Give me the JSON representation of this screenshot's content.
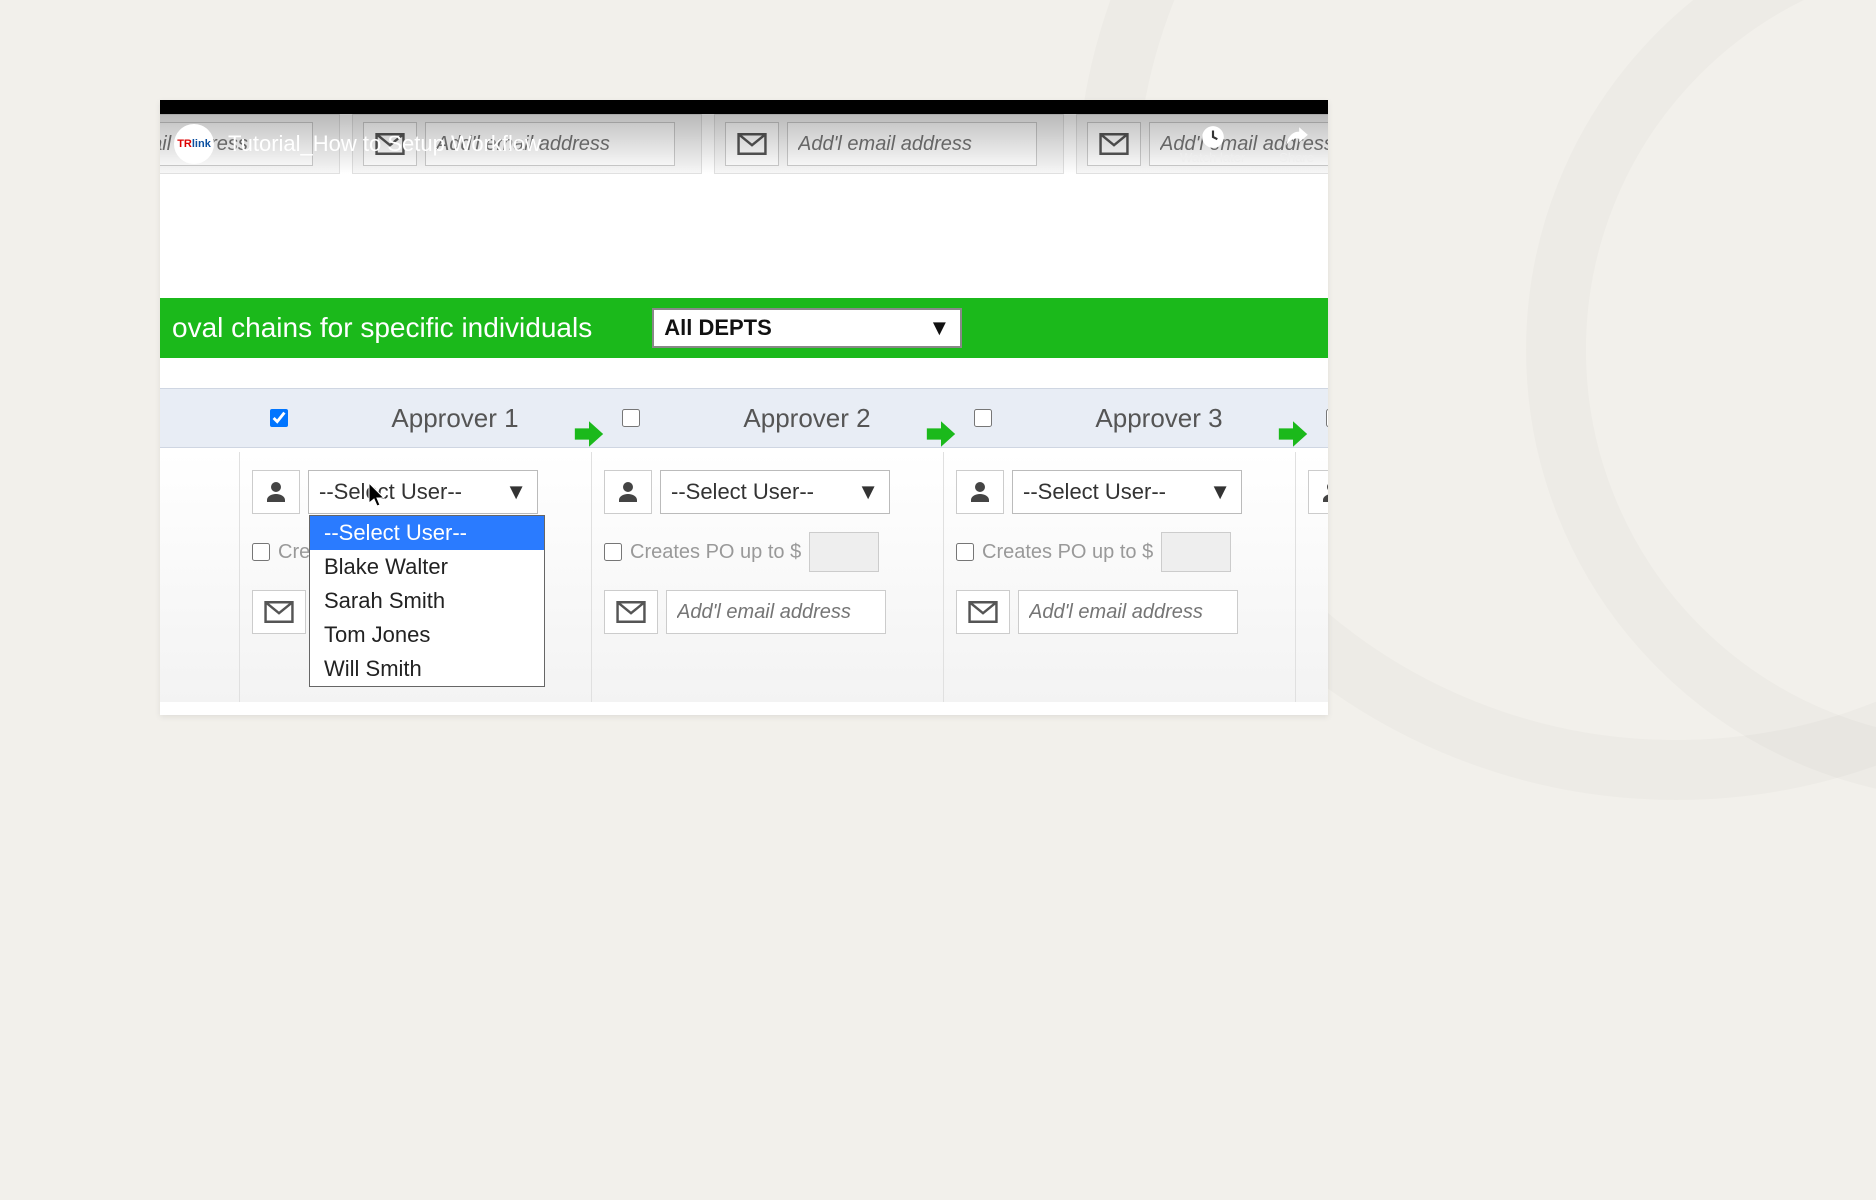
{
  "video": {
    "title": "Tutorial_How to Setup Workflow",
    "channel_logo_text": "TRlink",
    "watch_later_label": "Watch later",
    "share_label": "Share"
  },
  "banner": {
    "text_fragment": "oval chains for specific individuals",
    "dept_select_value": "All DEPTS"
  },
  "email_placeholder": "Add'l email address",
  "approvers": {
    "columns": [
      {
        "label": "Approver 1",
        "checked": true
      },
      {
        "label": "Approver 2",
        "checked": false
      },
      {
        "label": "Approver 3",
        "checked": false
      }
    ],
    "select_placeholder": "--Select User--",
    "po_label": "Creates PO up to $",
    "dropdown_options": [
      "--Select User--",
      "Blake Walter",
      "Sarah Smith",
      "Tom Jones",
      "Will Smith"
    ]
  },
  "colors": {
    "green": "#1bb91b",
    "highlight_blue": "#2a7bff"
  }
}
